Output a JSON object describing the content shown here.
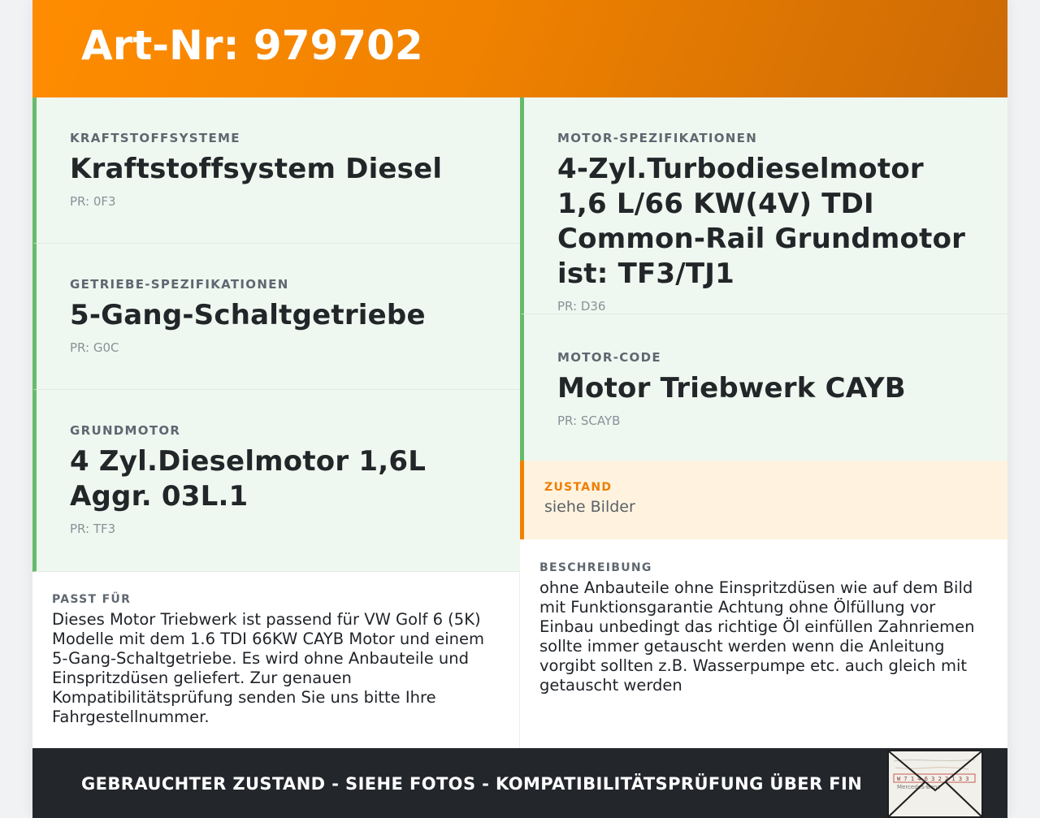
{
  "header": {
    "title": "Art-Nr: 979702"
  },
  "left_specs": [
    {
      "category": "KRAFTSTOFFSYSTEME",
      "value": "Kraftstoffsystem Diesel",
      "pr": "PR: 0F3"
    },
    {
      "category": "GETRIEBE-SPEZIFIKATIONEN",
      "value": "5-Gang-Schaltgetriebe",
      "pr": "PR: G0C"
    },
    {
      "category": "GRUNDMOTOR",
      "value": "4 Zyl.Dieselmotor 1,6L Aggr. 03L.1",
      "pr": "PR: TF3"
    }
  ],
  "right_specs": [
    {
      "category": "MOTOR-SPEZIFIKATIONEN",
      "value": "4-Zyl.Turbodieselmotor 1,6 L/66 KW(4V) TDI Common-Rail Grundmotor ist: TF3/TJ1",
      "pr": "PR: D36"
    },
    {
      "category": "MOTOR-CODE",
      "value": "Motor Triebwerk CAYB",
      "pr": "PR: SCAYB"
    }
  ],
  "zustand": {
    "label": "ZUSTAND",
    "value": "siehe Bilder"
  },
  "passt_fuer": {
    "label": "PASST FÜR",
    "text": "Dieses Motor Triebwerk ist passend für VW Golf 6 (5K) Modelle mit dem 1.6 TDI 66KW CAYB Motor und einem 5-Gang-Schaltgetriebe. Es wird ohne Anbauteile und Einspritzdüsen geliefert. Zur genauen Kompatibilitätsprüfung senden Sie uns bitte Ihre Fahrgestellnummer."
  },
  "beschreibung": {
    "label": "BESCHREIBUNG",
    "text": "ohne Anbauteile ohne Einspritzdüsen wie auf dem Bild mit Funktionsgarantie Achtung ohne Ölfüllung vor Einbau unbedingt das richtige Öl einfüllen Zahnriemen sollte immer getauscht werden wenn die Anleitung vorgibt sollten z.B. Wasserpumpe etc. auch gleich mit getauscht werden"
  },
  "footer": {
    "message": "GEBRAUCHTER ZUSTAND - SIEHE FOTOS - KOMPATIBILITÄTSPRÜFUNG ÜBER FIN",
    "stamp_text": "W  7 1 4 6 3 2 2 1 3 3",
    "stamp_brand": "Mercedes-Benz"
  }
}
